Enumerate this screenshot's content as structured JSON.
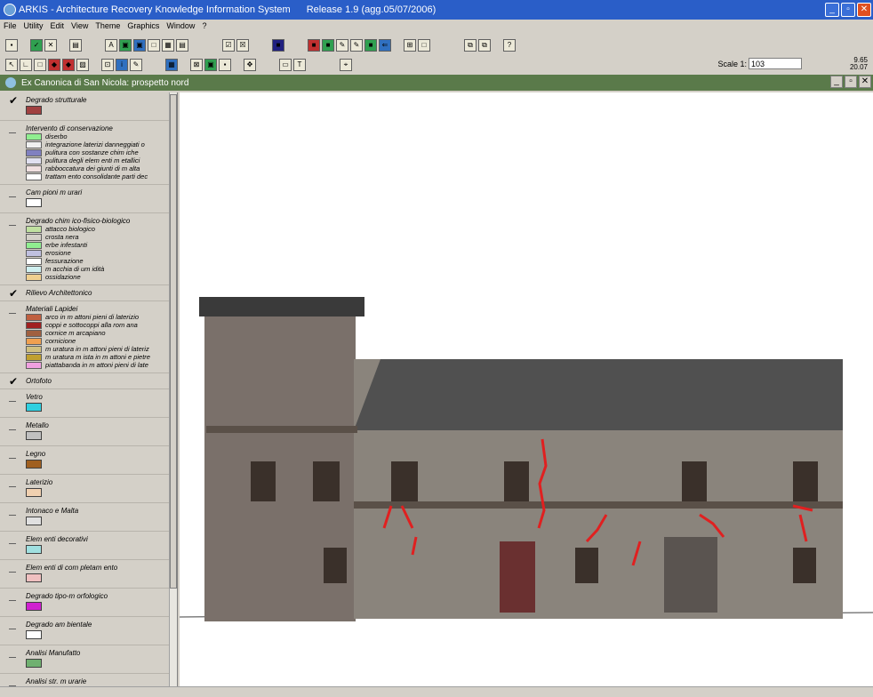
{
  "app": {
    "title": "ARKIS - Architecture Recovery Knowledge Information System",
    "release": "Release 1.9  (agg.05/07/2006)"
  },
  "menu": [
    "File",
    "Utility",
    "Edit",
    "View",
    "Theme",
    "Graphics",
    "Window",
    "?"
  ],
  "toolbar": {
    "scale_label": "Scale 1:",
    "scale_value": "103",
    "coord_x": "9.65",
    "coord_y": "20.07"
  },
  "document": {
    "title": "Ex Canonica di San Nicola: prospetto nord"
  },
  "layers": [
    {
      "name": "Degrado strutturale",
      "checked": true,
      "items": [
        {
          "label": "",
          "color": "#a04040"
        }
      ]
    },
    {
      "name": "Intervento di conservazione",
      "checked": false,
      "items": [
        {
          "label": "diserbo",
          "color": "#90ee90"
        },
        {
          "label": "integrazione laterizi danneggiati o",
          "color": "#f0f0f0"
        },
        {
          "label": "pulitura con sostanze chim iche",
          "color": "#8080c0"
        },
        {
          "label": "pulitura degli elem enti m etallici",
          "color": "#e0e0f0"
        },
        {
          "label": "rabboccatura dei giunti di m alta",
          "color": "#f0e0e0"
        },
        {
          "label": "trattam ento consolidante parti dec",
          "color": "#ffffff"
        }
      ]
    },
    {
      "name": "Cam pioni m urari",
      "checked": false,
      "items": [
        {
          "label": "",
          "color": "#ffffff"
        }
      ]
    },
    {
      "name": "Degrado chim ico-fisico-biologico",
      "checked": false,
      "items": [
        {
          "label": "attacco biologico",
          "color": "#c0e0a0"
        },
        {
          "label": "crosta nera",
          "color": "#d4d0c8"
        },
        {
          "label": "erbe infestanti",
          "color": "#90ee90"
        },
        {
          "label": "erosione",
          "color": "#c0c0e0"
        },
        {
          "label": "fessurazione",
          "color": "#ffffff"
        },
        {
          "label": "m acchia di um idità",
          "color": "#d0f0f0"
        },
        {
          "label": "ossidazione",
          "color": "#f0d090"
        }
      ]
    },
    {
      "name": "Rilievo Architettonico",
      "checked": true,
      "items": []
    },
    {
      "name": "Materiali Lapidei",
      "checked": false,
      "items": [
        {
          "label": "arco in m attoni pieni di laterizio",
          "color": "#c06040"
        },
        {
          "label": "coppi e sottocoppi alla rom ana",
          "color": "#a02020"
        },
        {
          "label": "cornice m arcapiano",
          "color": "#a06040"
        },
        {
          "label": "cornicione",
          "color": "#f0a050"
        },
        {
          "label": "m uratura in m attoni pieni di lateriz",
          "color": "#d0c080"
        },
        {
          "label": "m uratura m ista in m attoni e pietre",
          "color": "#c0a030"
        },
        {
          "label": "piattabanda in m attoni pieni di late",
          "color": "#f0a0e0"
        }
      ]
    },
    {
      "name": "Ortofoto",
      "checked": true,
      "items": []
    },
    {
      "name": "Vetro",
      "checked": false,
      "items": [
        {
          "label": "",
          "color": "#30d0e0"
        }
      ]
    },
    {
      "name": "Metallo",
      "checked": false,
      "items": [
        {
          "label": "",
          "color": "#c0c0c0"
        }
      ]
    },
    {
      "name": "Legno",
      "checked": false,
      "items": [
        {
          "label": "",
          "color": "#a06020"
        }
      ]
    },
    {
      "name": "Laterizio",
      "checked": false,
      "items": [
        {
          "label": "",
          "color": "#f0d0b0"
        }
      ]
    },
    {
      "name": "Intonaco e Malta",
      "checked": false,
      "items": [
        {
          "label": "",
          "color": "#e0e0e0"
        }
      ]
    },
    {
      "name": "Elem enti decorativi",
      "checked": false,
      "items": [
        {
          "label": "",
          "color": "#a0e0e0"
        }
      ]
    },
    {
      "name": "Elem enti di com pletam ento",
      "checked": false,
      "items": [
        {
          "label": "",
          "color": "#f0c0c0"
        }
      ]
    },
    {
      "name": "Degrado tipo-m orfologico",
      "checked": false,
      "items": [
        {
          "label": "",
          "color": "#d020d0"
        }
      ]
    },
    {
      "name": "Degrado am bientale",
      "checked": false,
      "items": [
        {
          "label": "",
          "color": "#ffffff"
        }
      ]
    },
    {
      "name": "Analisi Manufatto",
      "checked": false,
      "items": [
        {
          "label": "",
          "color": "#70b070"
        }
      ]
    },
    {
      "name": "Analisi str. m urarie",
      "checked": false,
      "items": [
        {
          "label": "",
          "color": "#f0d070"
        }
      ]
    }
  ]
}
